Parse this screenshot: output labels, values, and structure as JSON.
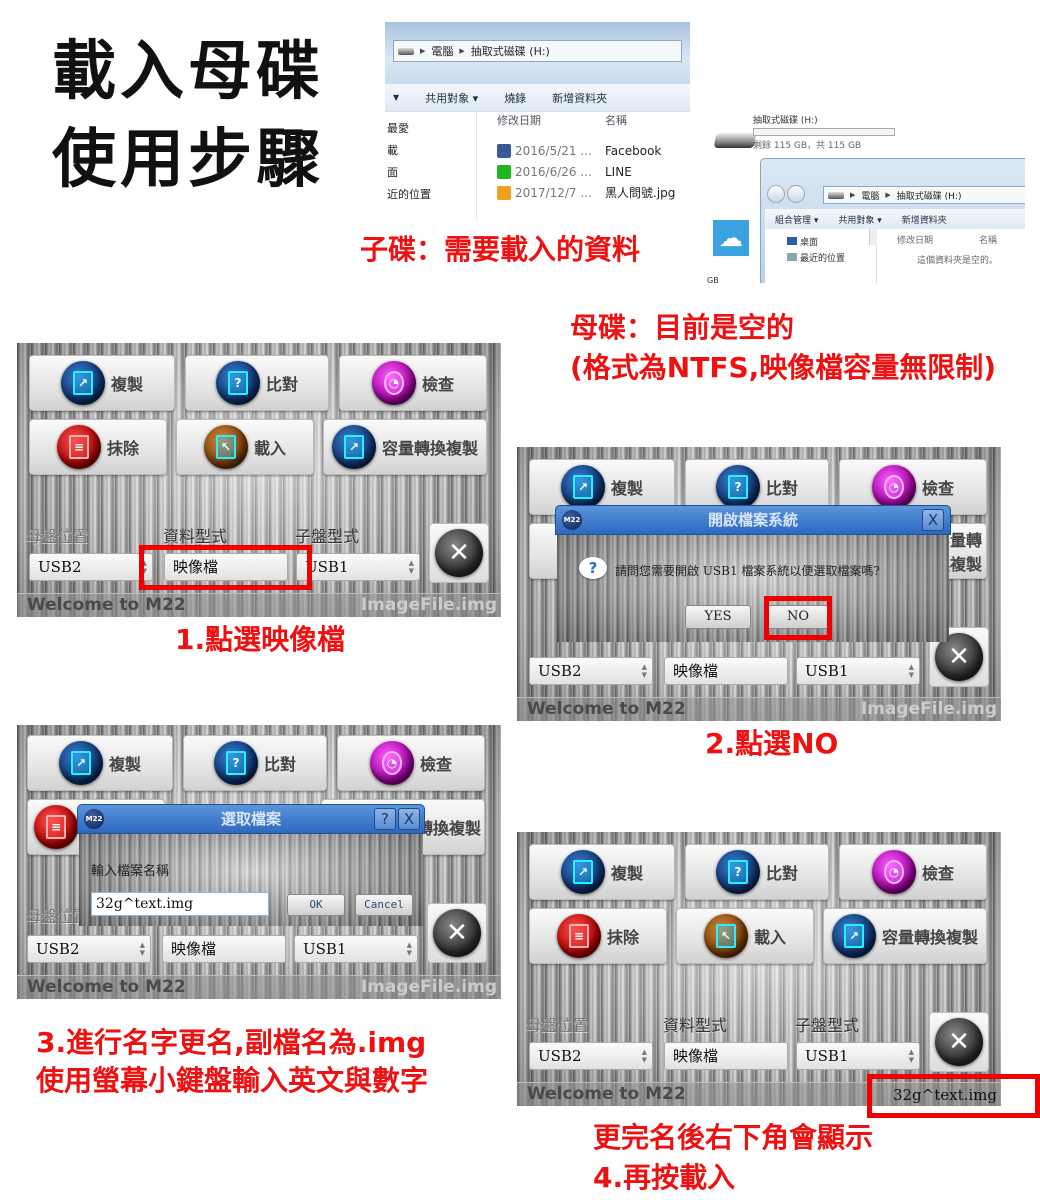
{
  "title": {
    "line1": "載入母碟",
    "line2": "使用步驟"
  },
  "annotations": {
    "child_disk": "子碟：需要載入的資料",
    "mother_disk_line1": "母碟：目前是空的",
    "mother_disk_line2": "(格式為NTFS,映像檔容量無限制)",
    "step1": "1.點選映像檔",
    "step2": "2.點選NO",
    "step3_line1": "3.進行名字更名,副檔名為.img",
    "step3_line2": "使用螢幕小鍵盤輸入英文與數字",
    "step4_line1": "更完名後右下角會顯示",
    "step4_line2": "4.再按載入"
  },
  "explorer_child": {
    "breadcrumb": [
      "電腦",
      "抽取式磁碟 (H:)"
    ],
    "toolbar": [
      "共用對象 ▾",
      "燒錄",
      "新增資料夾"
    ],
    "nav": [
      "最愛",
      "載",
      "面",
      "近的位置"
    ],
    "columns": [
      "修改日期",
      "名稱"
    ],
    "files": [
      {
        "date": "2016/5/21 ...",
        "name": "Facebook",
        "icon": "shortcut-facebook-icon",
        "color": "#3b5998"
      },
      {
        "date": "2016/6/26 ...",
        "name": "LINE",
        "icon": "shortcut-line-icon",
        "color": "#1fb71f"
      },
      {
        "date": "2017/12/7 ...",
        "name": "黑人問號.jpg",
        "icon": "image-file-icon",
        "color": "#f0a020"
      }
    ]
  },
  "explorer_mother": {
    "drive_label": "抽取式磁碟 (H:)",
    "drive_free": "剩餘 115 GB，共 115 GB",
    "drive_used_fraction": 0,
    "breadcrumb": [
      "電腦",
      "抽取式磁碟 (H:)"
    ],
    "toolbar": [
      "組合管理 ▾",
      "共用對象 ▾",
      "新增資料夾"
    ],
    "nav": [
      "桌面",
      "最近的位置"
    ],
    "columns": [
      "修改日期",
      "名稱"
    ],
    "empty_message": "這個資料夾是空的。",
    "size_fragment": "GB"
  },
  "m22": {
    "buttons": {
      "copy": "複製",
      "compare": "比對",
      "check": "檢查",
      "erase": "抹除",
      "load": "載入",
      "capacity_copy": "容量轉換複製"
    },
    "labels": {
      "mother_location": "母盤位置",
      "data_type": "資料型式",
      "child_type": "子盤型式"
    },
    "selects": {
      "mother_location": "USB2",
      "data_type": "映像檔",
      "child_type": "USB1"
    },
    "status_welcome": "Welcome to M22",
    "status_file_default": "ImageFile.img",
    "status_file_renamed": "32g^text.img",
    "logo": "M22"
  },
  "dialog_open_fs": {
    "title": "開啟檔案系統",
    "message": "請問您需要開啟 USB1 檔案系統以便選取檔案嗎?",
    "yes": "YES",
    "no": "NO",
    "close": "X"
  },
  "dialog_select_file": {
    "title": "選取檔案",
    "prompt": "輸入檔案名稱",
    "input_value": "32g^text.img",
    "ok": "OK",
    "cancel": "Cancel",
    "help": "?",
    "close": "X"
  }
}
